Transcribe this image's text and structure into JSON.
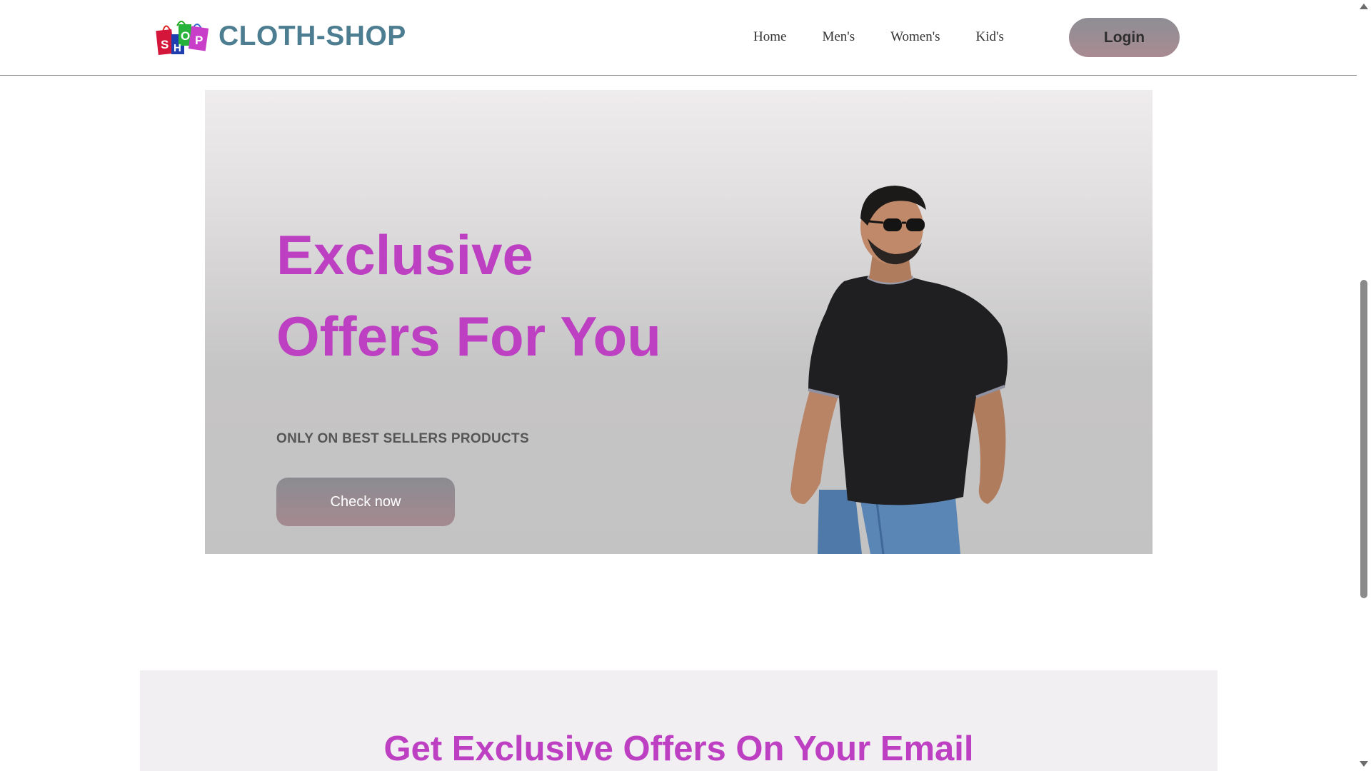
{
  "header": {
    "brand": "CLOTH-SHOP",
    "logo_icon": "shopping-bags-icon",
    "logo_letters": [
      "S",
      "H",
      "O",
      "P"
    ],
    "nav": [
      {
        "label": "Home"
      },
      {
        "label": "Men's"
      },
      {
        "label": "Women's"
      },
      {
        "label": "Kid's"
      }
    ],
    "login_label": "Login"
  },
  "hero": {
    "title_line1": "Exclusive",
    "title_line2": "Offers For You",
    "subtitle": "ONLY ON BEST SELLERS PRODUCTS",
    "cta_label": "Check now",
    "image": "man-in-black-tshirt-sunglasses"
  },
  "newsletter": {
    "title": "Get Exclusive Offers On Your Email"
  },
  "colors": {
    "brand": "#4d7d90",
    "accent": "#bd3fc2",
    "button_top": "#8e8e94",
    "button_bottom": "#a98b92"
  }
}
